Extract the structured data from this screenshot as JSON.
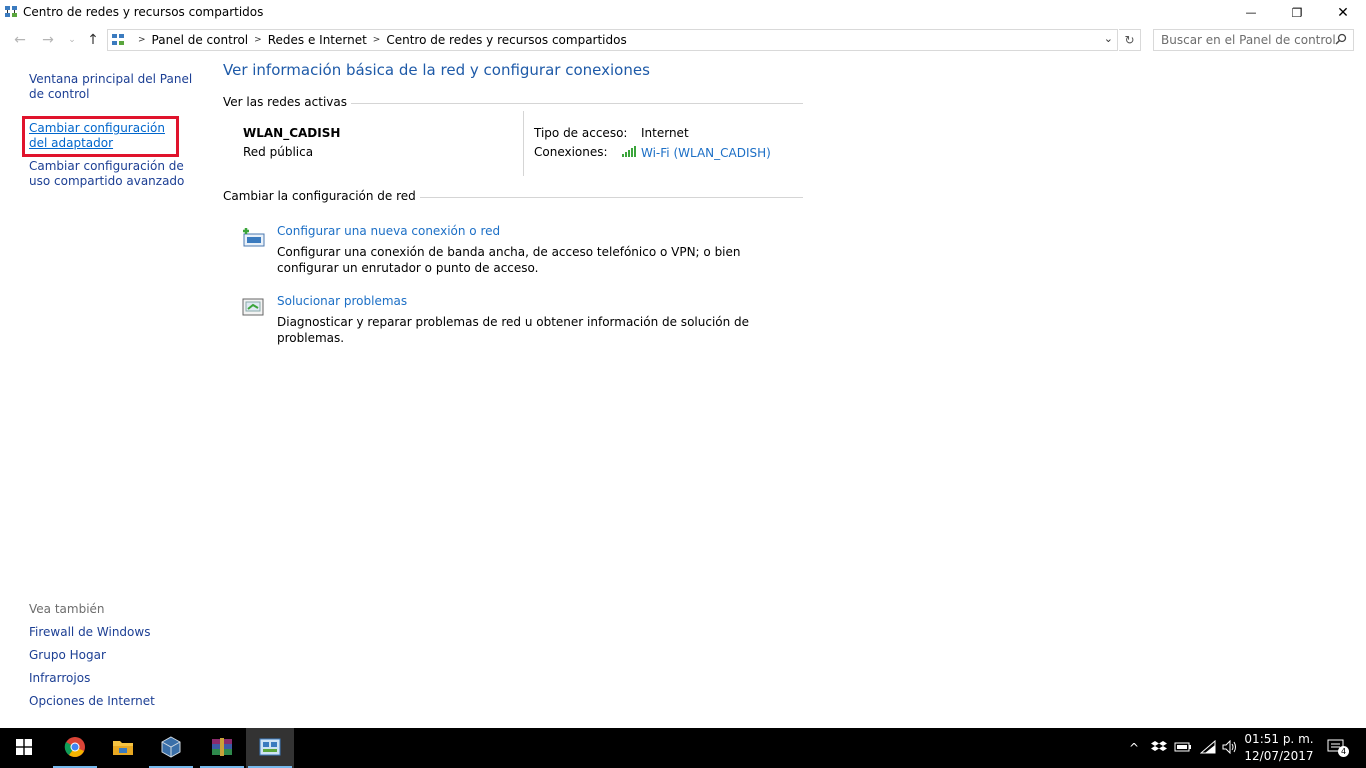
{
  "window": {
    "title": "Centro de redes y recursos compartidos",
    "minimize_glyph": "—",
    "restore_glyph": "❐",
    "close_glyph": "✕"
  },
  "address": {
    "crumbs": [
      "Panel de control",
      "Redes e Internet",
      "Centro de redes y recursos compartidos"
    ],
    "search_placeholder": "Buscar en el Panel de control"
  },
  "sidebar": {
    "home_link": "Ventana principal del Panel de control",
    "adapter_link": "Cambiar configuración del adaptador",
    "sharing_link": "Cambiar configuración de uso compartido avanzado",
    "see_also_header": "Vea también",
    "see_also": [
      "Firewall de Windows",
      "Grupo Hogar",
      "Infrarrojos",
      "Opciones de Internet"
    ]
  },
  "main": {
    "title": "Ver información básica de la red y configurar conexiones",
    "active_networks_label": "Ver las redes activas",
    "network": {
      "name": "WLAN_CADISH",
      "type": "Red pública",
      "access_label": "Tipo de acceso:",
      "access_value": "Internet",
      "connections_label": "Conexiones:",
      "connection_value": "Wi-Fi (WLAN_CADISH)"
    },
    "change_settings_label": "Cambiar la configuración de red",
    "tasks": [
      {
        "title": "Configurar una nueva conexión o red",
        "description": "Configurar una conexión de banda ancha, de acceso telefónico o VPN; o bien configurar un enrutador o punto de acceso."
      },
      {
        "title": "Solucionar problemas",
        "description": "Diagnosticar y reparar problemas de red u obtener información de solución de problemas."
      }
    ]
  },
  "taskbar": {
    "time": "01:51 p. m.",
    "date": "12/07/2017",
    "notification_count": "4"
  },
  "colors": {
    "link": "#1c3f94",
    "accent_link": "#1c6fc6",
    "title_blue": "#1e5aa8",
    "highlight": "#e0132c"
  }
}
